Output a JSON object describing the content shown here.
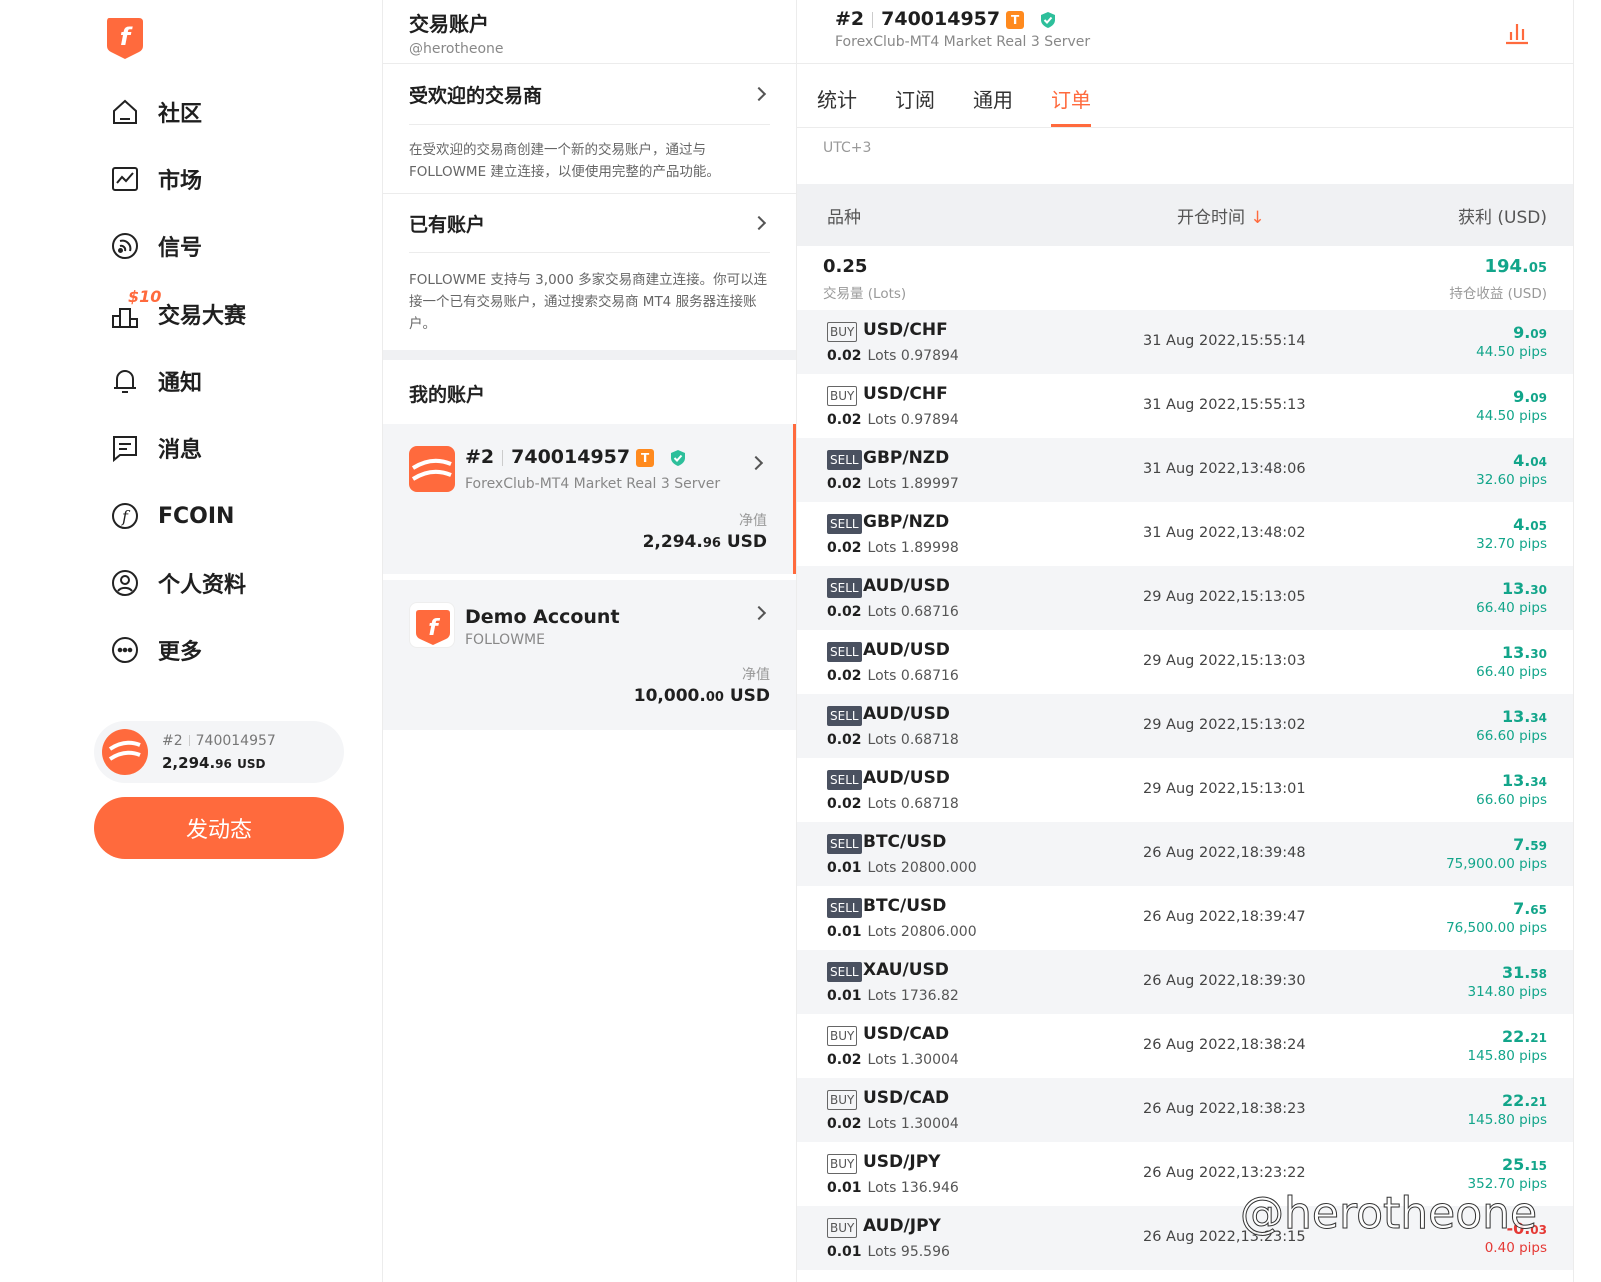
{
  "nav": {
    "items": [
      {
        "label": "社区",
        "icon": "home-icon"
      },
      {
        "label": "市场",
        "icon": "market-chart-icon"
      },
      {
        "label": "信号",
        "icon": "signal-icon"
      },
      {
        "label": "交易大赛",
        "icon": "contest-podium-icon",
        "badge": "$10"
      },
      {
        "label": "通知",
        "icon": "bell-icon"
      },
      {
        "label": "消息",
        "icon": "message-icon"
      },
      {
        "label": "FCOIN",
        "icon": "fcoin-icon"
      },
      {
        "label": "个人资料",
        "icon": "user-icon"
      },
      {
        "label": "更多",
        "icon": "more-icon"
      }
    ],
    "account_chip": {
      "number_prefix": "#2",
      "account": "740014957",
      "balance_main": "2,294.",
      "balance_dec": "96",
      "currency": "USD"
    },
    "post_button": "发动态"
  },
  "middle": {
    "title": "交易账户",
    "handle": "@herotheone",
    "popular_broker": {
      "title": "受欢迎的交易商",
      "desc": "在受欢迎的交易商创建一个新的交易账户，通过与 FOLLOWME 建立连接，以便使用完整的产品功能。"
    },
    "existing_account": {
      "title": "已有账户",
      "desc": "FOLLOWME 支持与 3,000 多家交易商建立连接。你可以连接一个已有交易账户，通过搜索交易商 MT4 服务器连接账户。"
    },
    "my_accounts_title": "我的账户",
    "accounts": [
      {
        "prefix": "#2",
        "number": "740014957",
        "tag": "T",
        "server": "ForexClub-MT4 Market Real 3 Server",
        "equity_label": "净值",
        "equity_main": "2,294.",
        "equity_dec": "96",
        "currency": "USD"
      },
      {
        "name": "Demo Account",
        "server": "FOLLOWME",
        "equity_label": "净值",
        "equity_main": "10,000.",
        "equity_dec": "00",
        "currency": "USD"
      }
    ]
  },
  "right": {
    "prefix": "#2",
    "number": "740014957",
    "tag": "T",
    "server": "ForexClub-MT4 Market Real 3 Server",
    "tabs": [
      "统计",
      "订阅",
      "通用",
      "订单"
    ],
    "active_tab": "订单",
    "timezone": "UTC+3",
    "columns": {
      "symbol": "品种",
      "open_time": "开仓时间",
      "sort_arrow": "↓",
      "profit": "获利 (USD)"
    },
    "summary": {
      "lots": "0.25",
      "lots_label": "交易量 (Lots)",
      "profit_main": "194.",
      "profit_dec": "05",
      "profit_label": "持仓收益 (USD)"
    },
    "orders": [
      {
        "side": "BUY",
        "symbol": "USD/CHF",
        "lots": "0.02",
        "lots_word": "Lots",
        "price": "0.97894",
        "time": "31 Aug 2022,15:55:14",
        "profit_main": "9.",
        "profit_dec": "09",
        "pips": "44.50 pips"
      },
      {
        "side": "BUY",
        "symbol": "USD/CHF",
        "lots": "0.02",
        "lots_word": "Lots",
        "price": "0.97894",
        "time": "31 Aug 2022,15:55:13",
        "profit_main": "9.",
        "profit_dec": "09",
        "pips": "44.50 pips"
      },
      {
        "side": "SELL",
        "symbol": "GBP/NZD",
        "lots": "0.02",
        "lots_word": "Lots",
        "price": "1.89997",
        "time": "31 Aug 2022,13:48:06",
        "profit_main": "4.",
        "profit_dec": "04",
        "pips": "32.60 pips"
      },
      {
        "side": "SELL",
        "symbol": "GBP/NZD",
        "lots": "0.02",
        "lots_word": "Lots",
        "price": "1.89998",
        "time": "31 Aug 2022,13:48:02",
        "profit_main": "4.",
        "profit_dec": "05",
        "pips": "32.70 pips"
      },
      {
        "side": "SELL",
        "symbol": "AUD/USD",
        "lots": "0.02",
        "lots_word": "Lots",
        "price": "0.68716",
        "time": "29 Aug 2022,15:13:05",
        "profit_main": "13.",
        "profit_dec": "30",
        "pips": "66.40 pips"
      },
      {
        "side": "SELL",
        "symbol": "AUD/USD",
        "lots": "0.02",
        "lots_word": "Lots",
        "price": "0.68716",
        "time": "29 Aug 2022,15:13:03",
        "profit_main": "13.",
        "profit_dec": "30",
        "pips": "66.40 pips"
      },
      {
        "side": "SELL",
        "symbol": "AUD/USD",
        "lots": "0.02",
        "lots_word": "Lots",
        "price": "0.68718",
        "time": "29 Aug 2022,15:13:02",
        "profit_main": "13.",
        "profit_dec": "34",
        "pips": "66.60 pips"
      },
      {
        "side": "SELL",
        "symbol": "AUD/USD",
        "lots": "0.02",
        "lots_word": "Lots",
        "price": "0.68718",
        "time": "29 Aug 2022,15:13:01",
        "profit_main": "13.",
        "profit_dec": "34",
        "pips": "66.60 pips"
      },
      {
        "side": "SELL",
        "symbol": "BTC/USD",
        "lots": "0.01",
        "lots_word": "Lots",
        "price": "20800.000",
        "time": "26 Aug 2022,18:39:48",
        "profit_main": "7.",
        "profit_dec": "59",
        "pips": "75,900.00 pips"
      },
      {
        "side": "SELL",
        "symbol": "BTC/USD",
        "lots": "0.01",
        "lots_word": "Lots",
        "price": "20806.000",
        "time": "26 Aug 2022,18:39:47",
        "profit_main": "7.",
        "profit_dec": "65",
        "pips": "76,500.00 pips"
      },
      {
        "side": "SELL",
        "symbol": "XAU/USD",
        "lots": "0.01",
        "lots_word": "Lots",
        "price": "1736.82",
        "time": "26 Aug 2022,18:39:30",
        "profit_main": "31.",
        "profit_dec": "58",
        "pips": "314.80 pips"
      },
      {
        "side": "BUY",
        "symbol": "USD/CAD",
        "lots": "0.02",
        "lots_word": "Lots",
        "price": "1.30004",
        "time": "26 Aug 2022,18:38:24",
        "profit_main": "22.",
        "profit_dec": "21",
        "pips": "145.80 pips"
      },
      {
        "side": "BUY",
        "symbol": "USD/CAD",
        "lots": "0.02",
        "lots_word": "Lots",
        "price": "1.30004",
        "time": "26 Aug 2022,18:38:23",
        "profit_main": "22.",
        "profit_dec": "21",
        "pips": "145.80 pips"
      },
      {
        "side": "BUY",
        "symbol": "USD/JPY",
        "lots": "0.01",
        "lots_word": "Lots",
        "price": "136.946",
        "time": "26 Aug 2022,13:23:22",
        "profit_main": "25.",
        "profit_dec": "15",
        "pips": "352.70 pips"
      },
      {
        "side": "BUY",
        "symbol": "AUD/JPY",
        "lots": "0.01",
        "lots_word": "Lots",
        "price": "95.596",
        "time": "26 Aug 2022,13:23:15",
        "profit_main": "-0.",
        "profit_dec": "03",
        "pips": "0.40 pips"
      }
    ]
  },
  "watermark": "@herotheone",
  "colors": {
    "accent": "#ff6a3d",
    "profit": "#12a58a",
    "loss": "#e53935"
  }
}
